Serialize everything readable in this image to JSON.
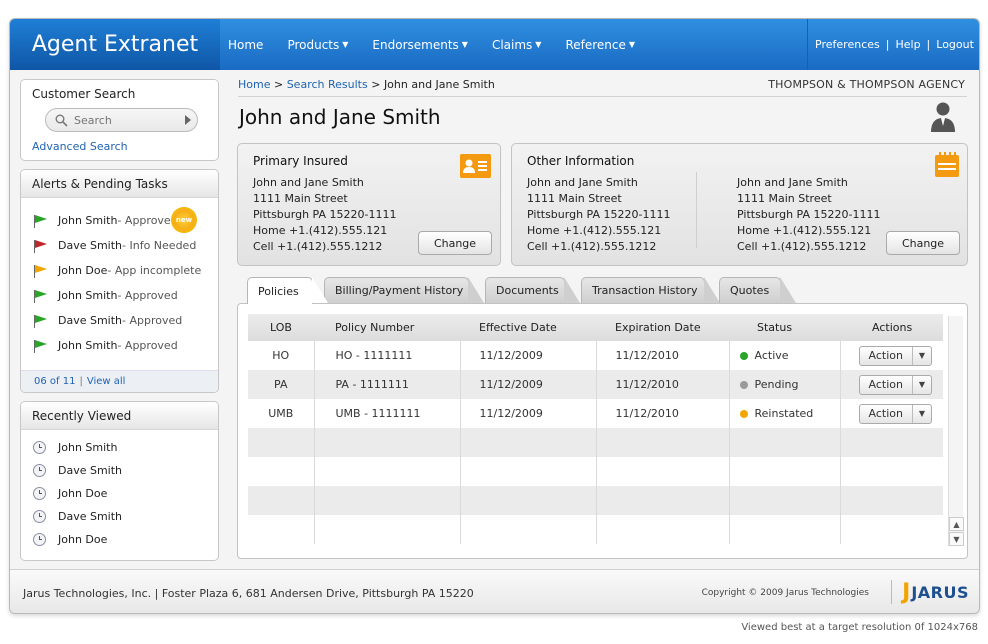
{
  "header": {
    "brand": "Agent Extranet",
    "nav": [
      {
        "label": "Home",
        "dropdown": false
      },
      {
        "label": "Products",
        "dropdown": true
      },
      {
        "label": "Endorsements",
        "dropdown": true
      },
      {
        "label": "Claims",
        "dropdown": true
      },
      {
        "label": "Reference",
        "dropdown": true
      }
    ],
    "util": {
      "preferences": "Preferences",
      "help": "Help",
      "logout": "Logout",
      "sep": "|"
    }
  },
  "customer_search": {
    "title": "Customer Search",
    "placeholder": "Search",
    "advanced": "Advanced Search"
  },
  "alerts": {
    "title": "Alerts & Pending Tasks",
    "items": [
      {
        "name": "John Smith",
        "status": " - Approved",
        "flag": "#2aa52a",
        "new": true
      },
      {
        "name": "Dave Smith",
        "status": " - Info Needed",
        "flag": "#c0262b",
        "new": false
      },
      {
        "name": "John Doe",
        "status": " - App incomplete",
        "flag": "#f1a600",
        "new": false
      },
      {
        "name": "John Smith",
        "status": " - Approved",
        "flag": "#2aa52a",
        "new": false
      },
      {
        "name": "Dave Smith",
        "status": " - Approved",
        "flag": "#2aa52a",
        "new": false
      },
      {
        "name": "John Smith",
        "status": " - Approved",
        "flag": "#2aa52a",
        "new": false
      }
    ],
    "badge_new": "new",
    "count": "06 of 11",
    "view_all": "View all",
    "sep": "|"
  },
  "recent": {
    "title": "Recently Viewed",
    "items": [
      "John Smith",
      "Dave Smith",
      "John Doe",
      "Dave Smith",
      "John Doe"
    ]
  },
  "breadcrumb": {
    "home": "Home",
    "sep1": " > ",
    "results": "Search Results",
    "sep2": " > ",
    "current": "John and Jane Smith"
  },
  "agency": "THOMPSON & THOMPSON AGENCY",
  "page_title": "John and Jane Smith",
  "primary": {
    "title": "Primary Insured",
    "lines": [
      "John and Jane Smith",
      "1111 Main Street",
      "Pittsburgh PA 15220-1111",
      "Home +1.(412).555.121",
      "Cell +1.(412).555.1212"
    ],
    "change": "Change"
  },
  "other": {
    "title": "Other Information",
    "col1": [
      "John and Jane Smith",
      "1111 Main Street",
      "Pittsburgh PA 15220-1111",
      "Home +1.(412).555.121",
      "Cell +1.(412).555.1212"
    ],
    "col2": [
      "John and Jane Smith",
      "1111 Main Street",
      "Pittsburgh PA 15220-1111",
      "Home +1.(412).555.121",
      "Cell +1.(412).555.1212"
    ],
    "change": "Change"
  },
  "tabs": [
    "Policies",
    "Billing/Payment History",
    "Documents",
    "Transaction History",
    "Quotes"
  ],
  "table": {
    "headers": [
      "LOB",
      "Policy Number",
      "Effective Date",
      "Expiration Date",
      "Status",
      "Actions"
    ],
    "rows": [
      {
        "lob": "HO",
        "policy": "HO - 1111111",
        "effective": "11/12/2009",
        "expiration": "11/12/2010",
        "status": "Active",
        "status_color": "#2aa52a",
        "action": "Action"
      },
      {
        "lob": "PA",
        "policy": "PA - 1111111",
        "effective": "11/12/2009",
        "expiration": "11/12/2010",
        "status": "Pending",
        "status_color": "#9a9a9a",
        "action": "Action"
      },
      {
        "lob": "UMB",
        "policy": "UMB - 1111111",
        "effective": "11/12/2009",
        "expiration": "11/12/2010",
        "status": "Reinstated",
        "status_color": "#f1a600",
        "action": "Action"
      }
    ],
    "empty_rows": 4
  },
  "footer": {
    "address": "Jarus Technologies, Inc.  |  Foster Plaza 6, 681 Andersen Drive, Pittsburgh PA 15220",
    "copyright": "Copyright © 2009 Jarus Technologies",
    "logo_j": "J",
    "logo_word": "JARUS"
  },
  "resolution_note": "Viewed best at a target resolution 0f 1024x768",
  "colors": {
    "header_blue": "#1a6bc3",
    "link_blue": "#1f63b0",
    "accent_orange": "#f39a10"
  }
}
